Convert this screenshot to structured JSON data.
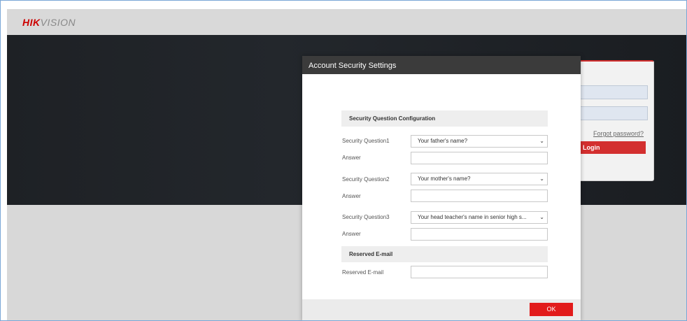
{
  "header": {
    "logo_hik": "HIK",
    "logo_vision": "VISION"
  },
  "login_panel": {
    "forgot_password": "Forgot password?",
    "login_button": "Login"
  },
  "dialog": {
    "title": "Account Security Settings",
    "section_security": "Security Question Configuration",
    "questions": [
      {
        "label": "Security Question1",
        "value": "Your father's name?",
        "answer_label": "Answer"
      },
      {
        "label": "Security Question2",
        "value": "Your mother's name?",
        "answer_label": "Answer"
      },
      {
        "label": "Security Question3",
        "value": "Your head teacher's name in senior high s...",
        "answer_label": "Answer"
      }
    ],
    "section_email": "Reserved E-mail",
    "email_label": "Reserved E-mail",
    "ok_button": "OK"
  },
  "colors": {
    "accent_red": "#e21b1b",
    "dialog_header": "#3b3b3b",
    "banner_dark": "#1e2125"
  }
}
